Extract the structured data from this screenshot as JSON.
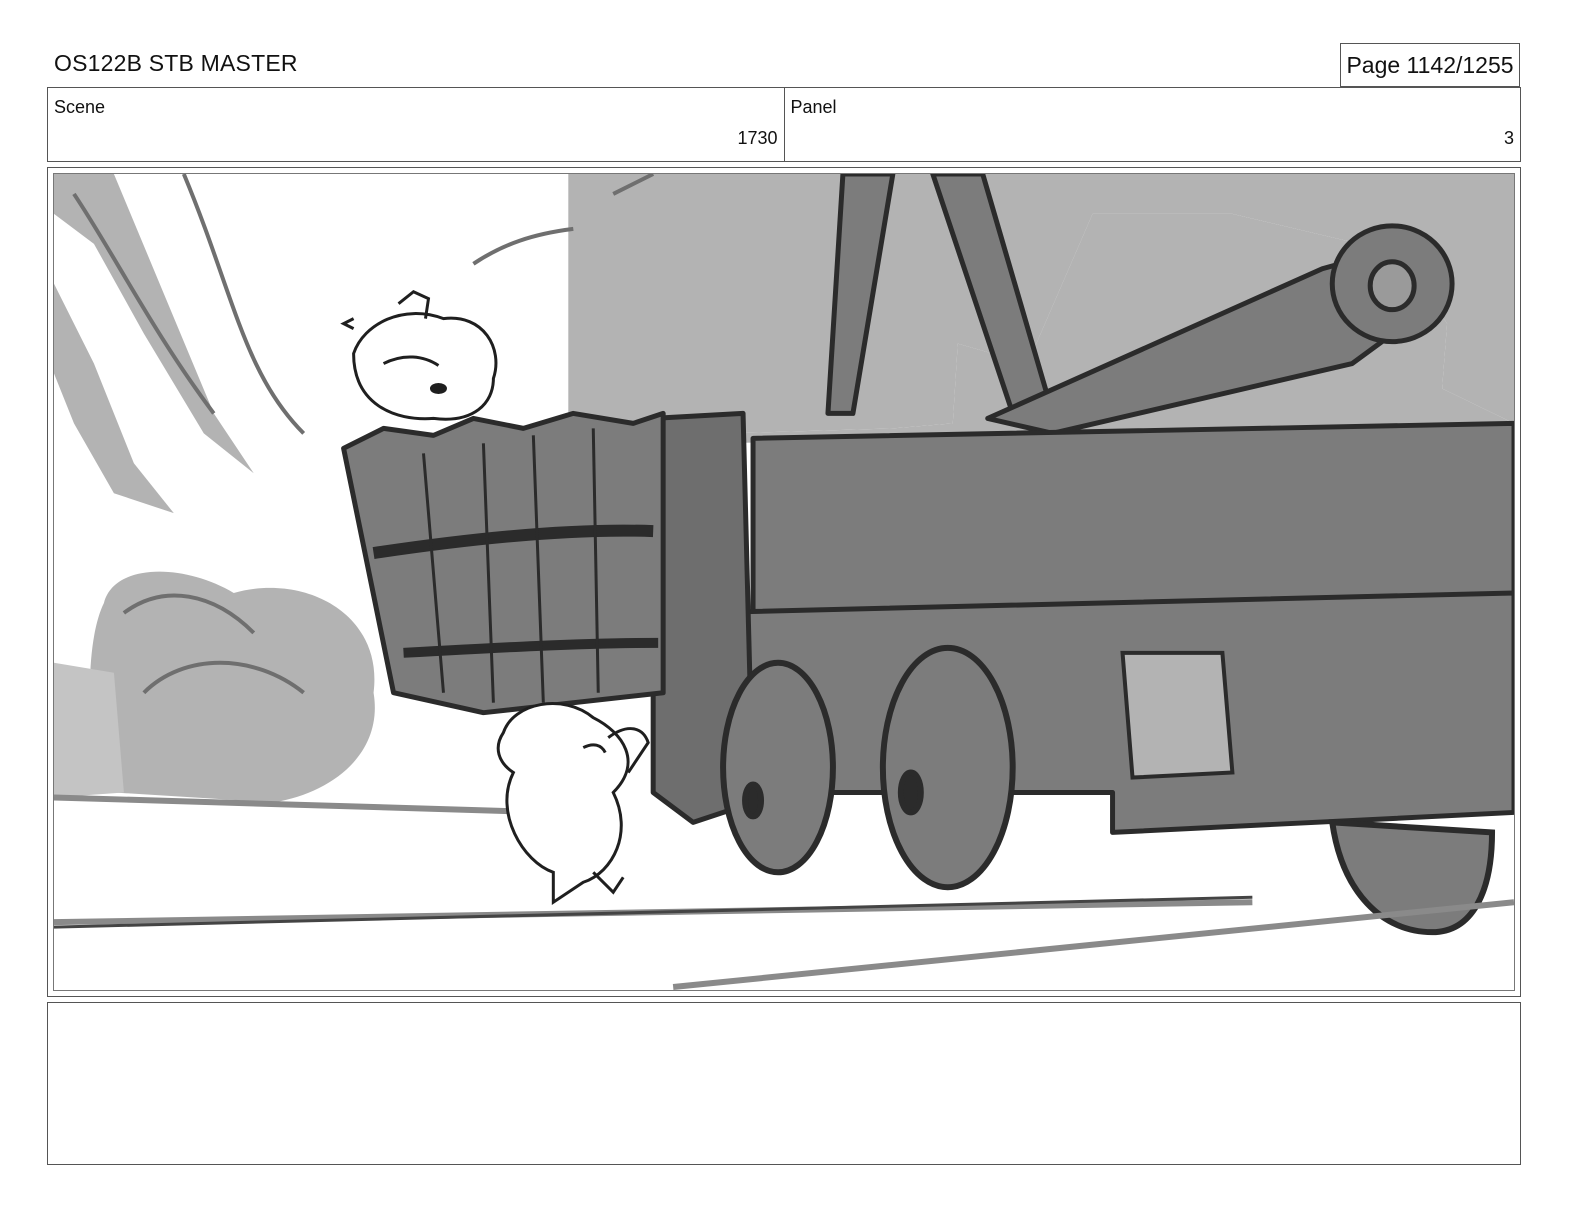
{
  "header": {
    "title": "OS122B STB MASTER",
    "page_label": "Page 1142/1255"
  },
  "info": {
    "scene_label": "Scene",
    "scene_value": "1730",
    "panel_label": "Panel",
    "panel_value": "3"
  },
  "colors": {
    "sketch_dark": "#2b2b2b",
    "tone_mid": "#7c7c7c",
    "tone_light": "#b3b3b3",
    "paper": "#ffffff"
  }
}
